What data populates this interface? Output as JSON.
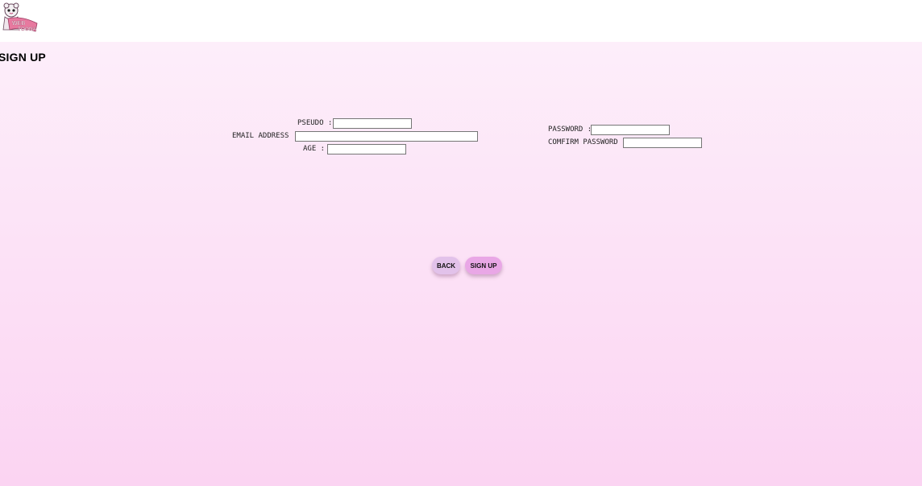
{
  "header": {
    "logo": {
      "text_top": "WEB",
      "text_bottom": "TOONA",
      "accent_color": "#d94c86"
    }
  },
  "page": {
    "title": "SIGN UP"
  },
  "form": {
    "pseudo": {
      "label": "PSEUDO :",
      "value": ""
    },
    "email": {
      "label": "EMAIL ADDRESS :",
      "value": ""
    },
    "age": {
      "label": "AGE :",
      "value": ""
    },
    "password": {
      "label": "PASSWORD :",
      "value": ""
    },
    "confirm_password": {
      "label": "COMFIRM PASSWORD :",
      "value": ""
    }
  },
  "buttons": {
    "back_label": "BACK",
    "signup_label": "SIGN UP"
  },
  "colors": {
    "gradient_top": "#fdeefa",
    "gradient_bottom": "#fbd4f2",
    "back_button": "#e2c2ea",
    "signup_button": "#e9a7e6"
  }
}
